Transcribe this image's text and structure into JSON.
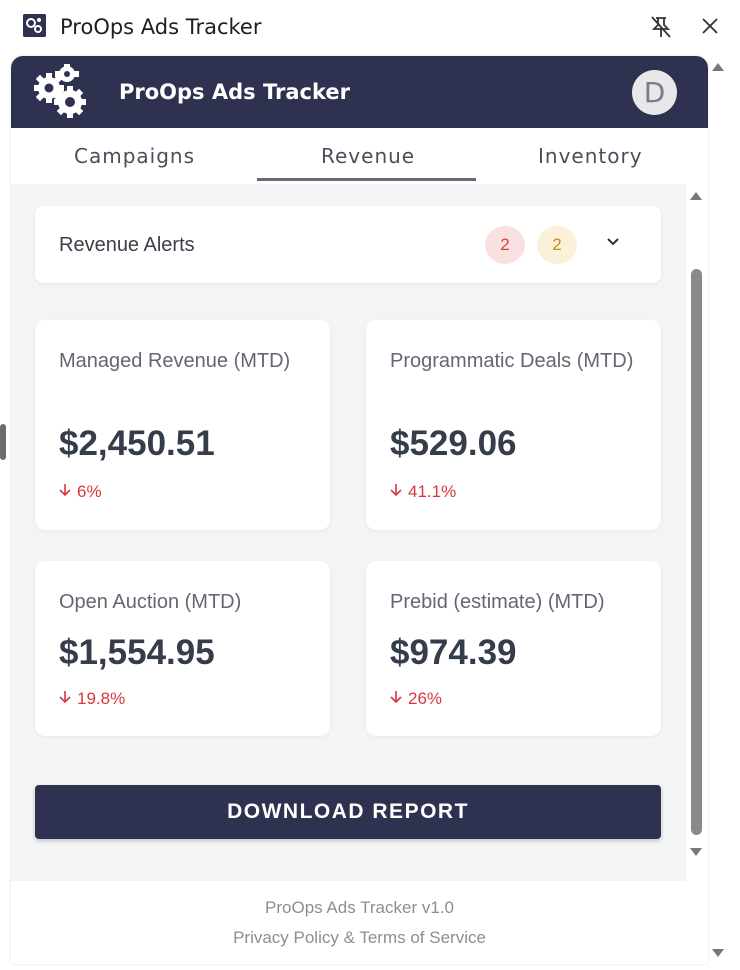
{
  "window": {
    "title": "ProOps Ads Tracker"
  },
  "header": {
    "title": "ProOps Ads Tracker",
    "avatar_initial": "D"
  },
  "tabs": [
    {
      "label": "Campaigns",
      "active": false
    },
    {
      "label": "Revenue",
      "active": true
    },
    {
      "label": "Inventory",
      "active": false
    }
  ],
  "alerts": {
    "title": "Revenue Alerts",
    "critical_count": "2",
    "warning_count": "2"
  },
  "cards": [
    {
      "label": "Managed Revenue (MTD)",
      "value": "$2,450.51",
      "change": "6%",
      "direction": "down"
    },
    {
      "label": "Programmatic Deals (MTD)",
      "value": "$529.06",
      "change": "41.1%",
      "direction": "down"
    },
    {
      "label": "Open Auction (MTD)",
      "value": "$1,554.95",
      "change": "19.8%",
      "direction": "down"
    },
    {
      "label": "Prebid (estimate) (MTD)",
      "value": "$974.39",
      "change": "26%",
      "direction": "down"
    }
  ],
  "actions": {
    "download_label": "DOWNLOAD REPORT"
  },
  "footer": {
    "version": "ProOps Ads Tracker v1.0",
    "links": "Privacy Policy & Terms of Service"
  },
  "colors": {
    "brand": "#2f3150",
    "negative": "#d7373f",
    "badge_red_bg": "#f9e1e1",
    "badge_yellow_bg": "#fbf0d8"
  }
}
